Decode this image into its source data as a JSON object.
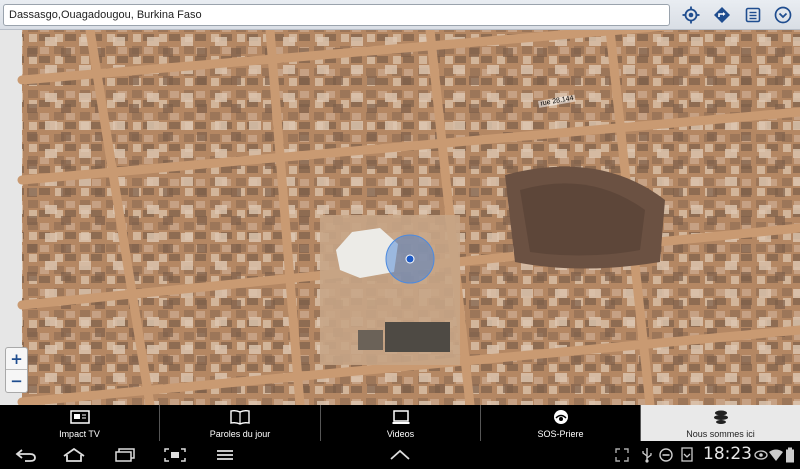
{
  "search": {
    "value": "Dassasgo,Ouagadougou, Burkina Faso"
  },
  "toolbar": {
    "icons": [
      "my-location-icon",
      "directions-icon",
      "list-icon",
      "dropdown-icon"
    ],
    "accent": "#1f4d8f"
  },
  "map": {
    "road_label": "rue 28.144",
    "zoom_in": "+",
    "zoom_out": "−"
  },
  "tabs": [
    {
      "label": "Impact TV",
      "icon": "tv-icon",
      "active": false
    },
    {
      "label": "Paroles du jour",
      "icon": "book-icon",
      "active": false
    },
    {
      "label": "Videos",
      "icon": "monitor-icon",
      "active": false
    },
    {
      "label": "SOS-Priere",
      "icon": "sos-icon",
      "active": false
    },
    {
      "label": "Nous sommes ici",
      "icon": "location-icon",
      "active": true
    }
  ],
  "system": {
    "time": "18:23"
  }
}
